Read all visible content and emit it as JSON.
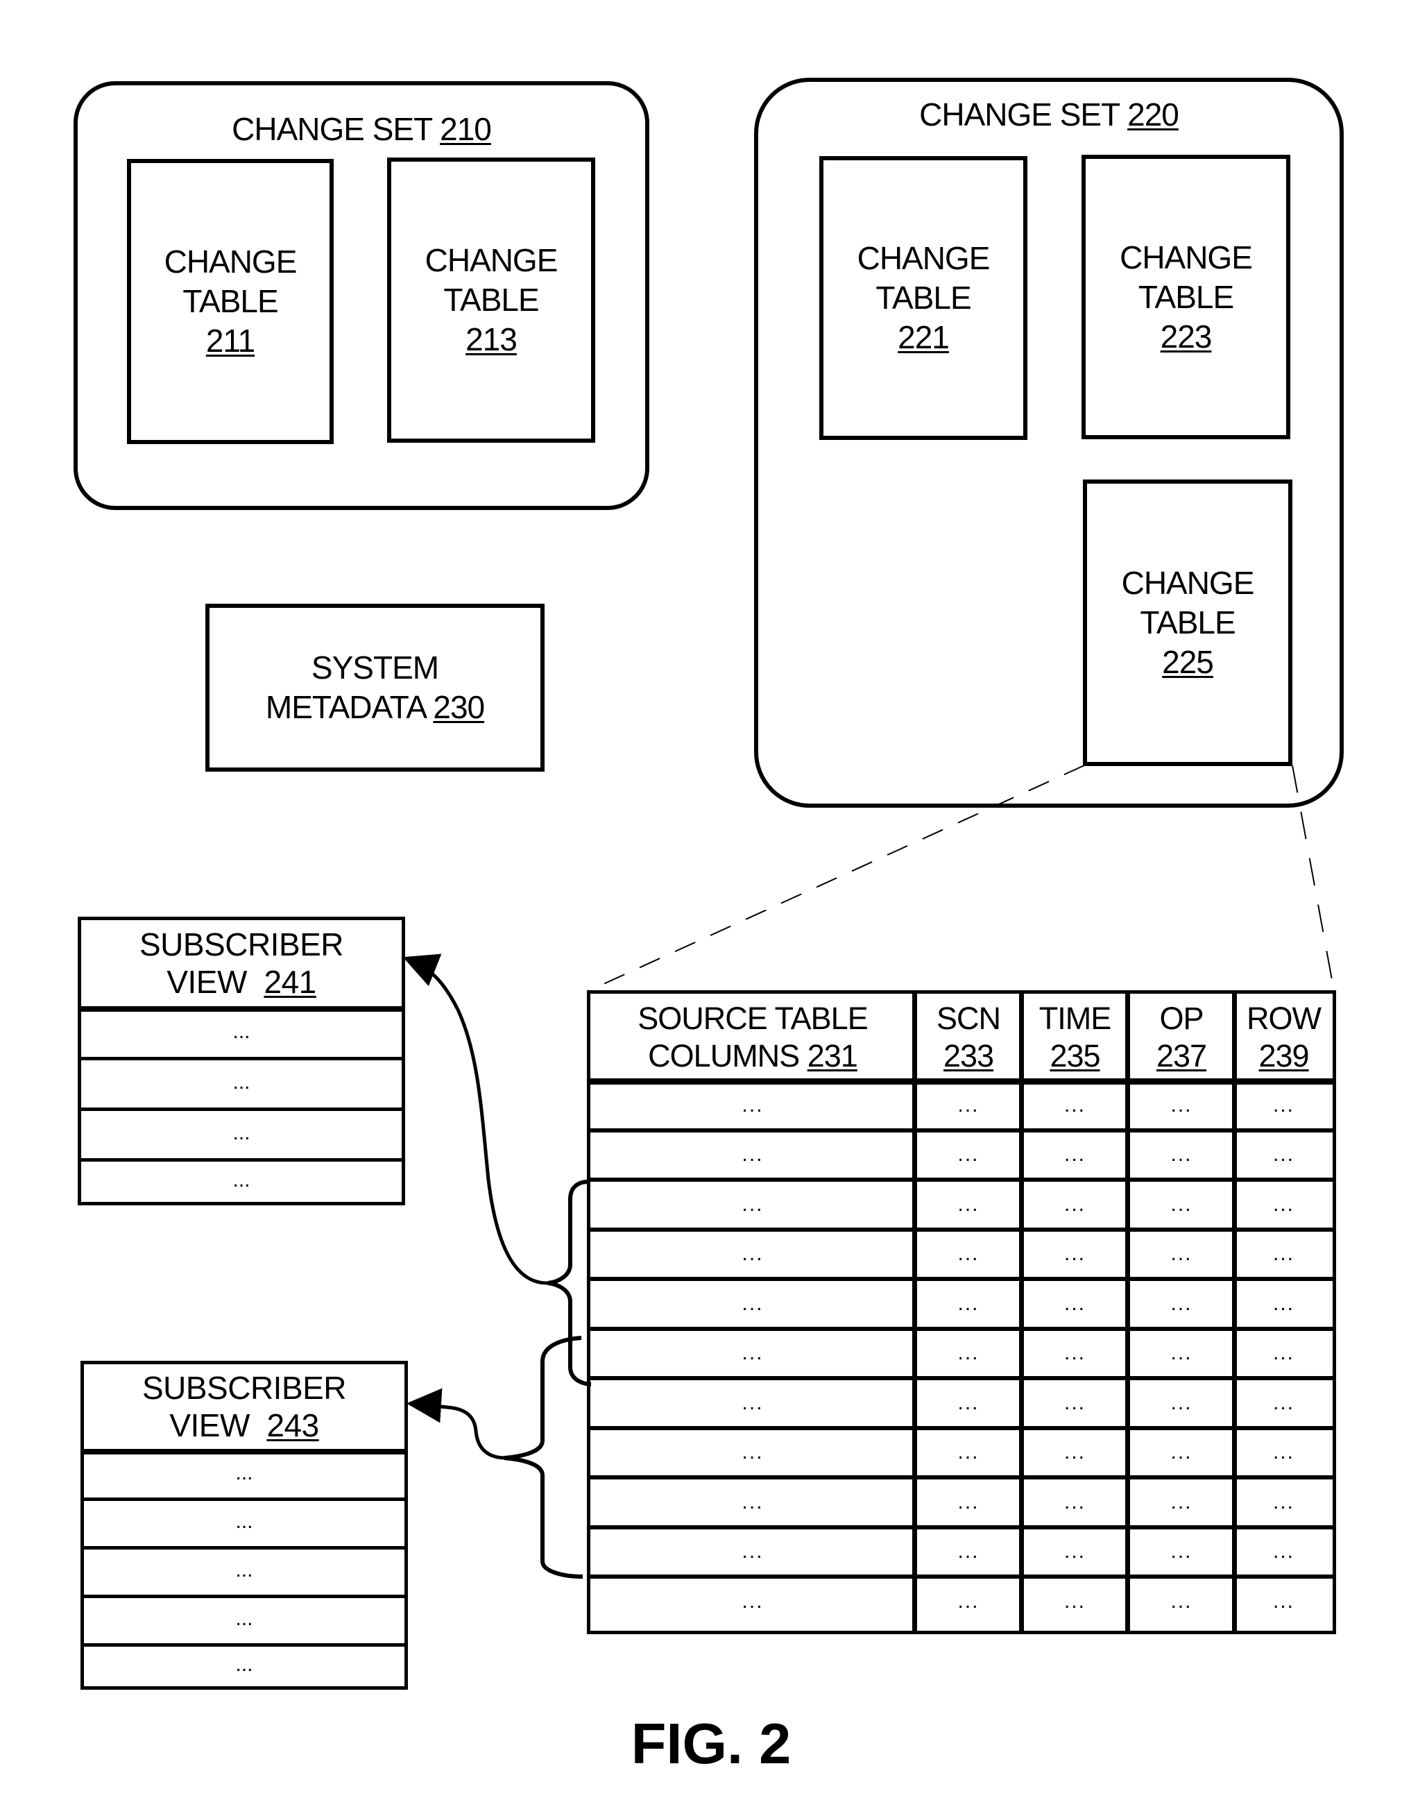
{
  "change_sets": [
    {
      "title": "CHANGE SET",
      "ref": "210",
      "tables": [
        {
          "line1": "CHANGE",
          "line2": "TABLE",
          "ref": "211"
        },
        {
          "line1": "CHANGE",
          "line2": "TABLE",
          "ref": "213"
        }
      ]
    },
    {
      "title": "CHANGE SET",
      "ref": "220",
      "tables": [
        {
          "line1": "CHANGE",
          "line2": "TABLE",
          "ref": "221"
        },
        {
          "line1": "CHANGE",
          "line2": "TABLE",
          "ref": "223"
        },
        {
          "line1": "CHANGE",
          "line2": "TABLE",
          "ref": "225"
        }
      ]
    }
  ],
  "system_metadata": {
    "line1": "SYSTEM",
    "line2": "METADATA",
    "ref": "230"
  },
  "subscriber_views": [
    {
      "line1": "SUBSCRIBER",
      "line2": "VIEW",
      "ref": "241",
      "rows": [
        "...",
        "...",
        "...",
        "..."
      ]
    },
    {
      "line1": "SUBSCRIBER",
      "line2": "VIEW",
      "ref": "243",
      "rows": [
        "...",
        "...",
        "...",
        "...",
        "..."
      ]
    }
  ],
  "change_table_detail": {
    "columns": [
      {
        "line1": "SOURCE TABLE",
        "line2": "COLUMNS",
        "ref": "231"
      },
      {
        "line1": "SCN",
        "line2": "",
        "ref": "233"
      },
      {
        "line1": "TIME",
        "line2": "",
        "ref": "235"
      },
      {
        "line1": "OP",
        "line2": "",
        "ref": "237"
      },
      {
        "line1": "ROW",
        "line2": "",
        "ref": "239"
      }
    ],
    "rows": [
      [
        "...",
        "...",
        "...",
        "...",
        "..."
      ],
      [
        "...",
        "...",
        "...",
        "...",
        "..."
      ],
      [
        "...",
        "...",
        "...",
        "...",
        "..."
      ],
      [
        "...",
        "...",
        "...",
        "...",
        "..."
      ],
      [
        "...",
        "...",
        "...",
        "...",
        "..."
      ],
      [
        "...",
        "...",
        "...",
        "...",
        "..."
      ],
      [
        "...",
        "...",
        "...",
        "...",
        "..."
      ],
      [
        "...",
        "...",
        "...",
        "...",
        "..."
      ],
      [
        "...",
        "...",
        "...",
        "...",
        "..."
      ],
      [
        "...",
        "...",
        "...",
        "...",
        "..."
      ],
      [
        "...",
        "...",
        "...",
        "...",
        "..."
      ]
    ],
    "expands_from": "CHANGE TABLE 225"
  },
  "mappings": [
    {
      "subscriber_view": "241",
      "table_rows": "3-6"
    },
    {
      "subscriber_view": "243",
      "table_rows": "6-10"
    }
  ],
  "figure_label": "FIG. 2"
}
